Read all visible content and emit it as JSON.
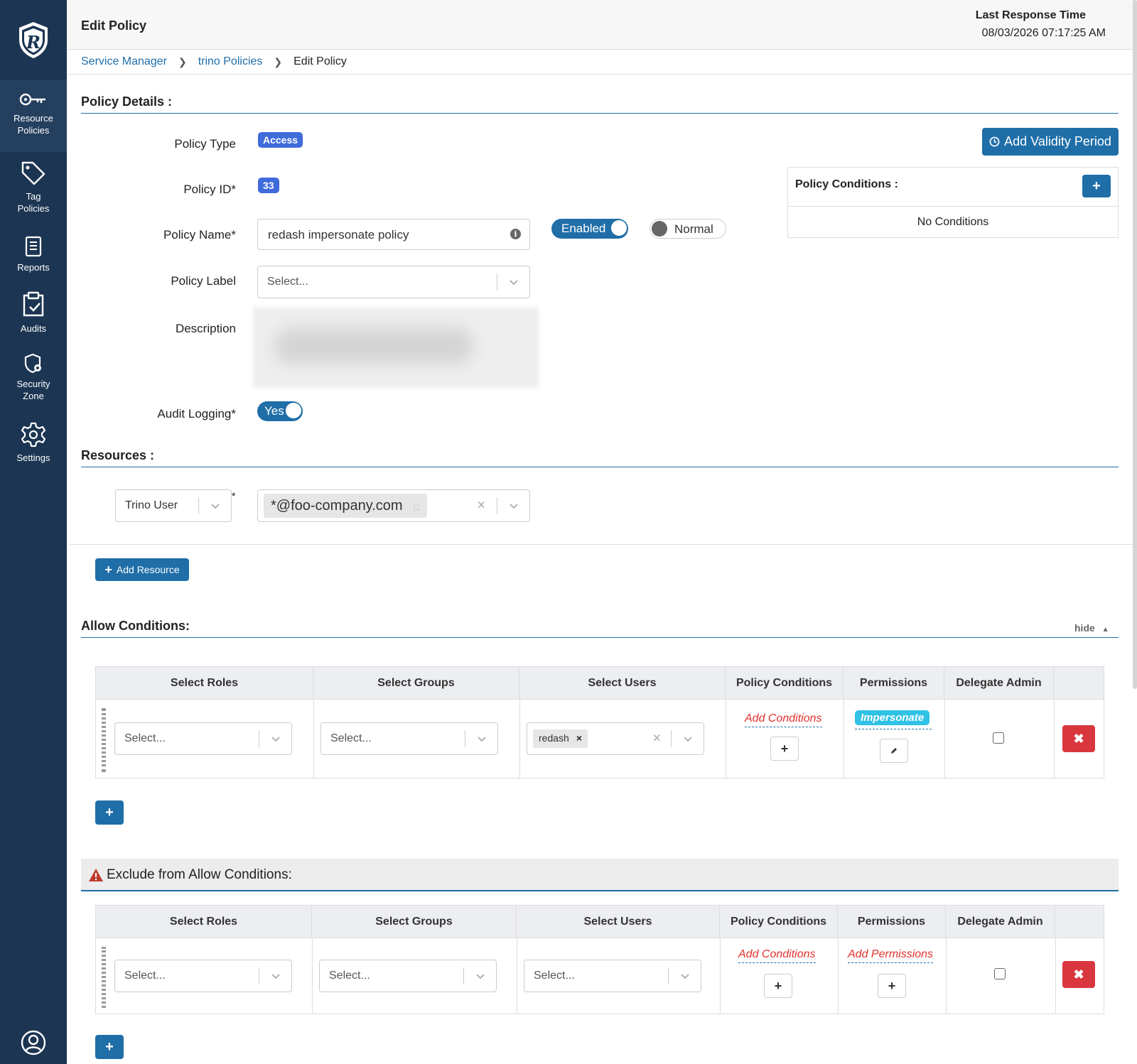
{
  "app": {
    "header_title": "Edit Policy",
    "last_response_label": "Last Response Time",
    "last_response_value": "08/03/2026 07:17:25 AM"
  },
  "sidebar": {
    "items": [
      {
        "label_line1": "Resource",
        "label_line2": "Policies",
        "icon": "key-icon",
        "active": true
      },
      {
        "label_line1": "Tag",
        "label_line2": "Policies",
        "icon": "tag-icon",
        "active": false
      },
      {
        "label_line1": "Reports",
        "label_line2": "",
        "icon": "report-icon",
        "active": false
      },
      {
        "label_line1": "Audits",
        "label_line2": "",
        "icon": "clipboard-check-icon",
        "active": false
      },
      {
        "label_line1": "Security",
        "label_line2": "Zone",
        "icon": "shield-lock-icon",
        "active": false
      },
      {
        "label_line1": "Settings",
        "label_line2": "",
        "icon": "gear-icon",
        "active": false
      }
    ]
  },
  "breadcrumb": {
    "items": [
      "Service Manager",
      "trino Policies",
      "Edit Policy"
    ]
  },
  "policy_details": {
    "section_title": "Policy Details :",
    "policy_type_label": "Policy Type",
    "policy_type_value": "Access",
    "policy_id_label": "Policy ID*",
    "policy_id_value": "33",
    "policy_name_label": "Policy Name*",
    "policy_name_value": "redash impersonate policy",
    "enabled_label": "Enabled",
    "normal_label": "Normal",
    "policy_label_label": "Policy Label",
    "policy_label_placeholder": "Select...",
    "description_label": "Description",
    "audit_logging_label": "Audit Logging*",
    "audit_logging_value": "Yes",
    "add_validity_label": "Add Validity Period",
    "conditions_title": "Policy Conditions :",
    "conditions_empty": "No Conditions"
  },
  "resources": {
    "section_title": "Resources :",
    "resource_type": "Trino User",
    "resource_value": "*@foo-company.com",
    "add_resource_label": "Add Resource"
  },
  "allow": {
    "section_title": "Allow Conditions:",
    "hide_label": "hide",
    "headers": [
      "Select Roles",
      "Select Groups",
      "Select Users",
      "Policy Conditions",
      "Permissions",
      "Delegate Admin"
    ],
    "roles_placeholder": "Select...",
    "groups_placeholder": "Select...",
    "user_chip": "redash",
    "add_conditions_label": "Add Conditions",
    "permission_badge": "Impersonate"
  },
  "exclude": {
    "section_title": "Exclude from Allow Conditions:",
    "headers": [
      "Select Roles",
      "Select Groups",
      "Select Users",
      "Policy Conditions",
      "Permissions",
      "Delegate Admin"
    ],
    "roles_placeholder": "Select...",
    "groups_placeholder": "Select...",
    "users_placeholder": "Select...",
    "add_conditions_label": "Add Conditions",
    "add_permissions_label": "Add Permissions"
  },
  "colors": {
    "sidebar_bg": "#1c3552",
    "primary": "#1f6ea8",
    "badge_blue": "#3f6bdb",
    "danger": "#d9363e",
    "permission_cyan": "#2fc1e6"
  }
}
